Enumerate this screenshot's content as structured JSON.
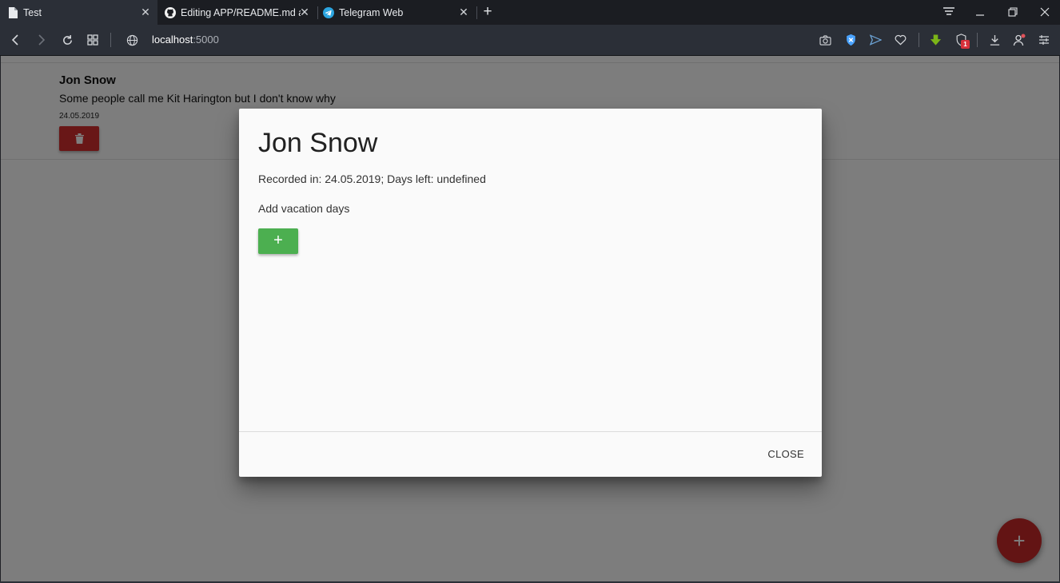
{
  "browser": {
    "tabs": [
      {
        "title": "Test",
        "icon": "document-icon",
        "active": true
      },
      {
        "title": "Editing APP/README.md a",
        "icon": "github-icon",
        "active": false
      },
      {
        "title": "Telegram Web",
        "icon": "telegram-icon",
        "active": false
      }
    ],
    "address": {
      "host": "localhost",
      "port": ":5000"
    },
    "extension_badge": "1"
  },
  "page": {
    "person": {
      "name": "Jon Snow",
      "description": "Some people call me Kit Harington but I don't know why",
      "date": "24.05.2019"
    }
  },
  "modal": {
    "title": "Jon Snow",
    "recorded": "Recorded in: 24.05.2019; Days left: undefined",
    "add_label": "Add vacation days",
    "add_button": "+",
    "close_label": "CLOSE"
  },
  "fab_label": "+",
  "colors": {
    "delete": "#d32f2f",
    "add": "#4caf50",
    "fab": "#c62828"
  }
}
